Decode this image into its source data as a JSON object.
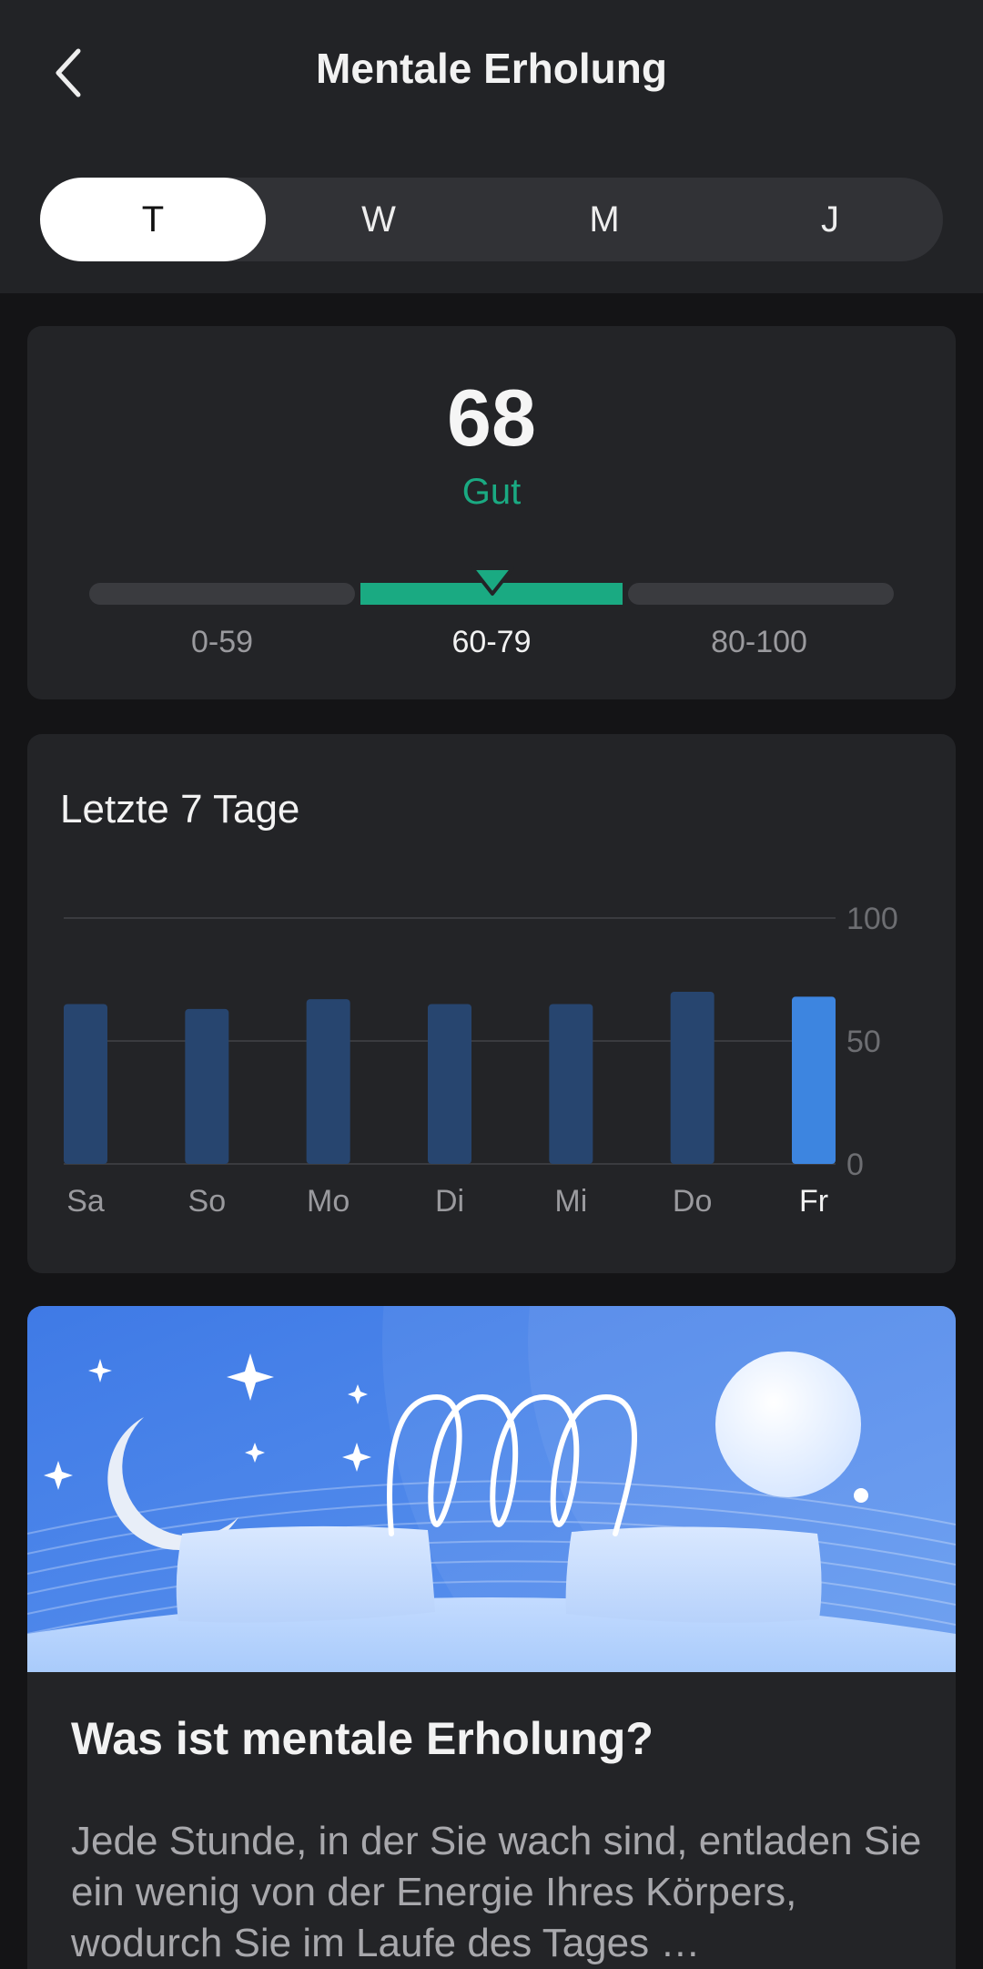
{
  "header": {
    "title": "Mentale Erholung",
    "back_icon": "chevron-left-icon"
  },
  "period_tabs": [
    {
      "label": "T",
      "active": true
    },
    {
      "label": "W",
      "active": false
    },
    {
      "label": "M",
      "active": false
    },
    {
      "label": "J",
      "active": false
    }
  ],
  "score": {
    "value": "68",
    "label": "Gut",
    "label_color": "#1aaa82",
    "ranges": [
      {
        "label": "0-59",
        "active": false
      },
      {
        "label": "60-79",
        "active": true
      },
      {
        "label": "80-100",
        "active": false
      }
    ]
  },
  "week": {
    "title": "Letzte 7 Tage"
  },
  "chart_data": {
    "type": "bar",
    "categories": [
      "Sa",
      "So",
      "Mo",
      "Di",
      "Mi",
      "Do",
      "Fr"
    ],
    "values": [
      65,
      63,
      67,
      65,
      65,
      70,
      68
    ],
    "highlight_index": 6,
    "ylim": [
      0,
      100
    ],
    "yticks": [
      "0",
      "50",
      "100"
    ],
    "grid": true,
    "colors": {
      "bar": "#27456f",
      "highlight": "#3d85e0"
    }
  },
  "info": {
    "title": "Was ist mentale Erholung?",
    "text": "Jede Stunde, in der Sie wach sind, entladen Sie ein wenig von der Energie Ihres Körpers, wodurch Sie im Laufe des Tages …"
  },
  "colors": {
    "accent": "#1aaa82",
    "background": "#141416",
    "card": "#232427"
  }
}
